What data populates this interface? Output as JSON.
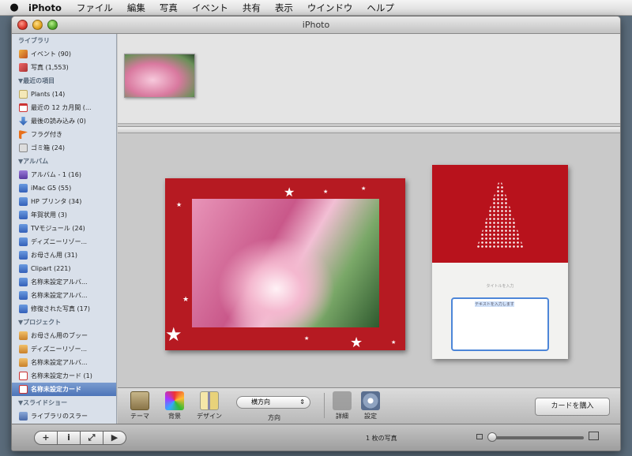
{
  "menubar": {
    "app": "iPhoto",
    "items": [
      "ファイル",
      "編集",
      "写真",
      "イベント",
      "共有",
      "表示",
      "ウインドウ",
      "ヘルプ"
    ]
  },
  "window": {
    "title": "iPhoto"
  },
  "sidebar": {
    "sections": [
      {
        "header": "ライブラリ",
        "items": [
          {
            "label": "イベント (90)",
            "icon": "event-icon"
          },
          {
            "label": "写真 (1,553)",
            "icon": "photos-icon"
          }
        ]
      },
      {
        "header": "▼最近の項目",
        "items": [
          {
            "label": "Plants (14)",
            "icon": "folder-icon"
          },
          {
            "label": "最近の 12 カ月間 (...",
            "icon": "calendar-icon"
          },
          {
            "label": "最後の読み込み (0)",
            "icon": "import-icon"
          },
          {
            "label": "フラグ付き",
            "icon": "flag-icon"
          },
          {
            "label": "ゴミ箱 (24)",
            "icon": "trash-icon"
          }
        ]
      },
      {
        "header": "▼アルバム",
        "items": [
          {
            "label": "アルバム - 1 (16)",
            "icon": "smart-album-icon"
          },
          {
            "label": "iMac G5 (55)",
            "icon": "album-icon"
          },
          {
            "label": "HP プリンタ (34)",
            "icon": "album-icon"
          },
          {
            "label": "年賀状用 (3)",
            "icon": "album-icon"
          },
          {
            "label": "TVモジュール (24)",
            "icon": "album-icon"
          },
          {
            "label": "ディズニーリゾー...",
            "icon": "album-icon"
          },
          {
            "label": "お母さん用 (31)",
            "icon": "album-icon"
          },
          {
            "label": "Clipart (221)",
            "icon": "album-icon"
          },
          {
            "label": "名称未設定アルバ...",
            "icon": "album-icon"
          },
          {
            "label": "名称未設定アルバ...",
            "icon": "album-icon"
          },
          {
            "label": "修復された写真 (17)",
            "icon": "album-icon"
          }
        ]
      },
      {
        "header": "▼プロジェクト",
        "items": [
          {
            "label": "お母さん用のブッー",
            "icon": "project-icon"
          },
          {
            "label": "ディズニーリゾー...",
            "icon": "project-icon"
          },
          {
            "label": "名称未設定アルバ...",
            "icon": "project-icon"
          },
          {
            "label": "名称未設定カード (1)",
            "icon": "card-icon"
          },
          {
            "label": "名称未設定カード",
            "icon": "card-icon",
            "selected": true
          }
        ]
      },
      {
        "header": "▼スライドショー",
        "items": [
          {
            "label": "ライブラリのスラー",
            "icon": "slideshow-icon"
          }
        ]
      }
    ]
  },
  "card": {
    "inside_caption": "タイトルを入力",
    "inside_text": "テキストを入力します"
  },
  "toolbar": {
    "theme_label": "テーマ",
    "background_label": "背景",
    "design_label": "デザイン",
    "orientation_value": "横方向",
    "orientation_label": "方向",
    "detail_label": "詳細",
    "settings_label": "設定",
    "buy_button": "カードを購入"
  },
  "statusbar": {
    "buttons": [
      "+",
      "i",
      "⤢",
      "▶"
    ],
    "count": "1 枚の写真",
    "zoom_level": 0.0
  }
}
